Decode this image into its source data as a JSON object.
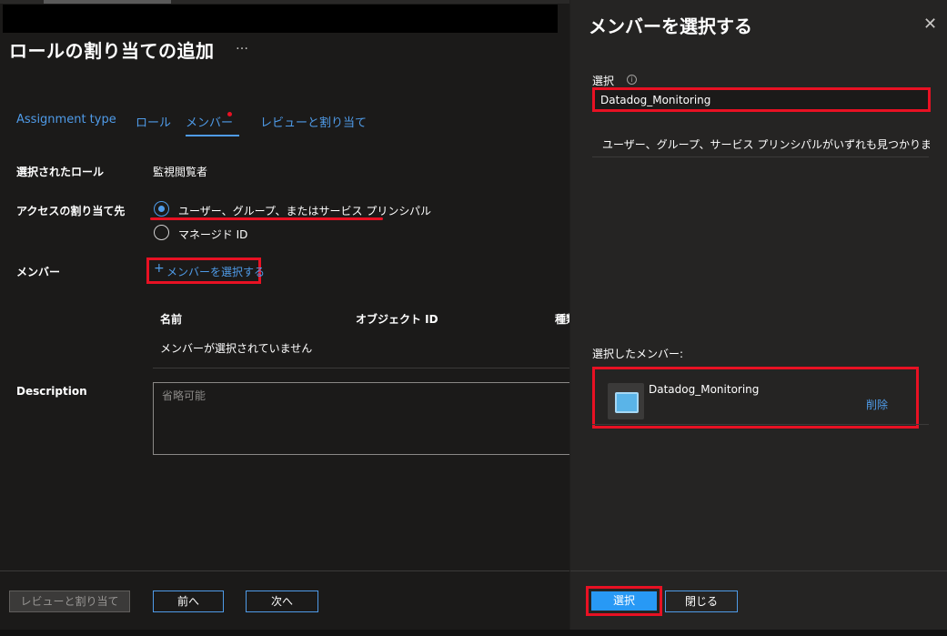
{
  "blade": {
    "title": "ロールの割り当ての追加",
    "more_icon": "ellipsis-icon",
    "more_label": "…",
    "tabs": [
      {
        "label": "Assignment type"
      },
      {
        "label": "ロール"
      },
      {
        "label": "メンバー"
      },
      {
        "label": "レビューと割り当て"
      }
    ],
    "selected_role_label": "選択されたロール",
    "selected_role_value": "監視閲覧者",
    "assign_access_label": "アクセスの割り当て先",
    "assign_options": [
      {
        "label": "ユーザー、グループ、またはサービス プリンシパル",
        "checked": true
      },
      {
        "label": "マネージド ID",
        "checked": false
      }
    ],
    "members_label": "メンバー",
    "add_member_label": "メンバーを選択する",
    "plus_glyph": "+",
    "table_headers": [
      "名前",
      "オブジェクト ID",
      "種類"
    ],
    "empty_members_text": "メンバーが選択されていません",
    "description_label": "Description",
    "description_placeholder": "省略可能"
  },
  "footer": {
    "review_assign": "レビューと割り当て",
    "prev": "前へ",
    "next": "次へ"
  },
  "panel": {
    "title": "メンバーを選択する",
    "close_icon": "close-icon",
    "close_glyph": "✕",
    "select_label": "選択",
    "info_glyph": "i",
    "search_value": "Datadog_Monitoring",
    "no_results_text": "ユーザー、グループ、サービス プリンシパルがいずれも見つかりませんでし…",
    "selected_members_label": "選択したメンバー:",
    "selected_members": [
      {
        "name": "Datadog_Monitoring",
        "remove_label": "削除"
      }
    ],
    "select_button": "選択",
    "close_button": "閉じる"
  },
  "colors": {
    "accent": "#4f9be8",
    "highlight_red": "#e81123",
    "primary_button": "#2899f5",
    "background": "#1b1a19",
    "panel_background": "#252423"
  }
}
